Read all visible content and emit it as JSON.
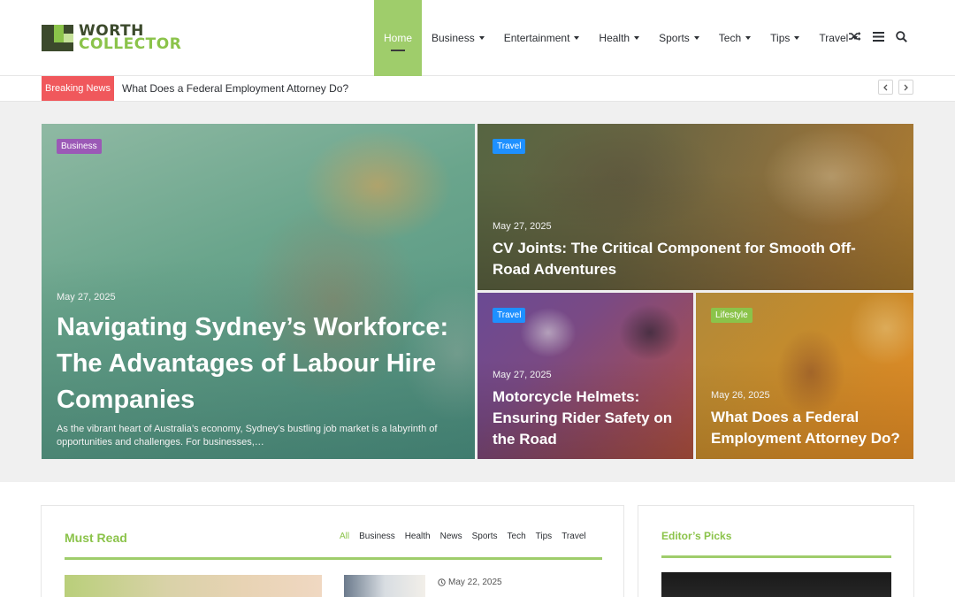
{
  "brand": {
    "line1": "WORTH",
    "line2": "COLLECTOR"
  },
  "nav": {
    "items": [
      {
        "label": "Home",
        "active": true
      },
      {
        "label": "Business",
        "dropdown": true
      },
      {
        "label": "Entertainment",
        "dropdown": true
      },
      {
        "label": "Health",
        "dropdown": true
      },
      {
        "label": "Sports",
        "dropdown": true
      },
      {
        "label": "Tech",
        "dropdown": true
      },
      {
        "label": "Tips",
        "dropdown": true
      },
      {
        "label": "Travel",
        "dropdown": true
      }
    ],
    "icons": [
      "shuffle-icon",
      "menu-icon",
      "search-icon"
    ]
  },
  "breaking": {
    "label": "Breaking News",
    "headline": "What Does a Federal Employment Attorney Do?"
  },
  "hero": {
    "main": {
      "category": "Business",
      "date": "May 27, 2025",
      "title": "Navigating Sydney’s Workforce: The Advantages of Labour Hire Companies",
      "excerpt": "As the vibrant heart of Australia’s economy, Sydney’s bustling job market is a labyrinth of opportunities and challenges. For businesses,…"
    },
    "top_right": {
      "category": "Travel",
      "date": "May 27, 2025",
      "title": "CV Joints: The Critical Component for Smooth Off-Road Adventures"
    },
    "bottom_left": {
      "category": "Travel",
      "date": "May 27, 2025",
      "title": "Motorcycle Helmets: Ensuring Rider Safety on the Road"
    },
    "bottom_right": {
      "category": "Lifestyle",
      "date": "May 26, 2025",
      "title": "What Does a Federal Employment Attorney Do?"
    }
  },
  "must_read": {
    "title": "Must Read",
    "tabs": [
      "All",
      "Business",
      "Health",
      "News",
      "Sports",
      "Tech",
      "Tips",
      "Travel"
    ],
    "active_tab": "All",
    "post_date": "May 22, 2025"
  },
  "editors_picks": {
    "title": "Editor’s Picks"
  },
  "colors": {
    "accent": "#8bc34a",
    "breaking": "#f0585c",
    "cat_business": "#9b59b6",
    "cat_travel": "#1e90ff",
    "cat_lifestyle": "#8bc34a"
  }
}
